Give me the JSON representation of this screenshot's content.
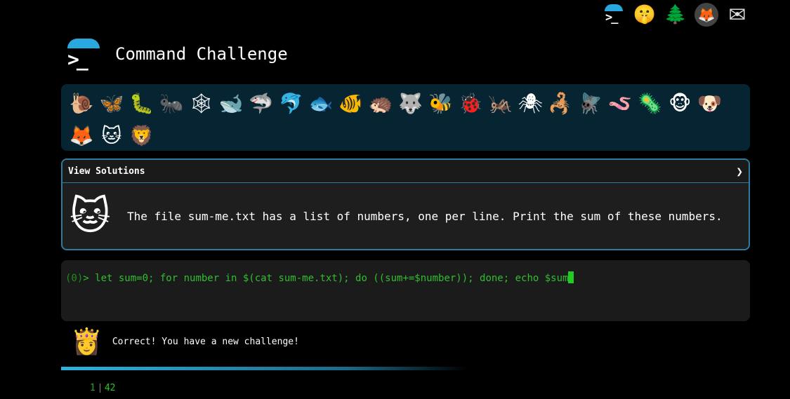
{
  "topnav": {
    "icons": [
      "terminal-icon",
      "shushing-face-icon",
      "tree-icon",
      "gitlab-icon",
      "mail-icon"
    ],
    "glyphs": {
      "terminal": ">_",
      "face": "🤫",
      "tree": "🌲",
      "gitlab": "🦊",
      "mail": "✉"
    }
  },
  "header": {
    "logo_glyph": ">_",
    "title": "Command Challenge"
  },
  "animals": [
    "🐌",
    "🦋",
    "🐛",
    "🐜",
    "🕸",
    "🐋",
    "🦈",
    "🐬",
    "🐟",
    "🐠",
    "🦔",
    "🐺",
    "🐝",
    "🐞",
    "🦗",
    "🕷",
    "🦂",
    "🪰",
    "🪱",
    "🦠",
    "🐵",
    "🐶",
    "🦊",
    "🐱",
    "🦁"
  ],
  "challenge": {
    "view_solutions_label": "View Solutions",
    "chevron": "❯",
    "icon": "🐱",
    "description": "The file sum-me.txt has a list of numbers, one per line. Print the sum of these numbers."
  },
  "terminal": {
    "counter": "(0)",
    "prompt": "> ",
    "command": "let sum=0; for number in $(cat sum-me.txt); do ((sum+=$number)); done; echo $sum"
  },
  "result": {
    "icon": "👸",
    "message": "Correct! You have a new challenge!"
  },
  "output": {
    "line_number": "1",
    "value": "42"
  },
  "colors": {
    "accent": "#29a8e0",
    "panel": "#072432",
    "terminal_text": "#2fbf2f"
  }
}
